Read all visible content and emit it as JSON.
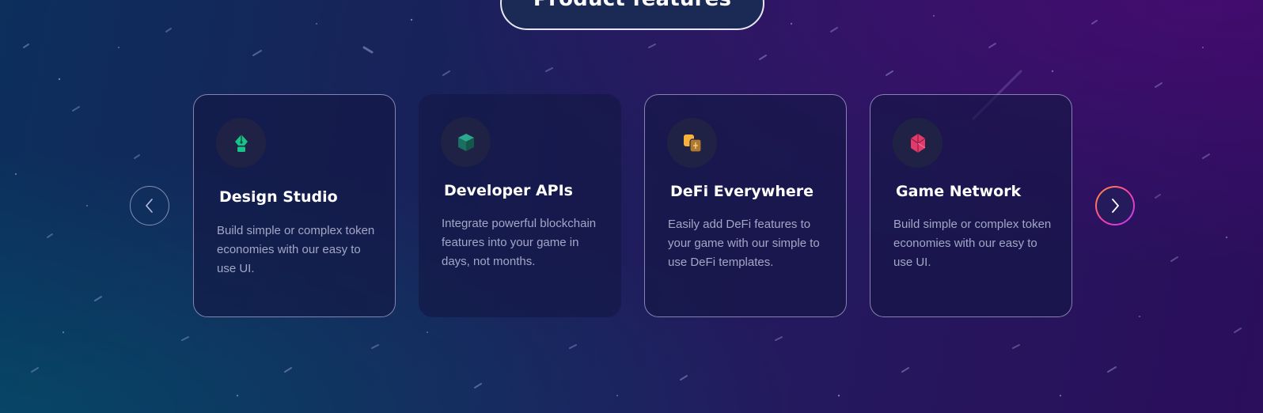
{
  "section": {
    "heading": "Product features"
  },
  "carousel": {
    "prev_icon": "chevron-left-icon",
    "next_icon": "chevron-right-icon",
    "cards": [
      {
        "title": "Design Studio",
        "description": "Build simple or complex token economies with our easy to use UI.",
        "icon": "pen-nib-icon",
        "icon_color": "#19c28a"
      },
      {
        "title": "Developer APIs",
        "description": "Integrate powerful blockchain features into your game in days, not months.",
        "icon": "cube-icon",
        "icon_color": "#1f8a78"
      },
      {
        "title": "DeFi Everywhere",
        "description": "Easily add DeFi features to your game with our simple to use DeFi templates.",
        "icon": "coins-icon",
        "icon_color": "#f6b23c"
      },
      {
        "title": "Game Network",
        "description": "Build simple or complex token economies with our easy to use UI.",
        "icon": "gem-icon",
        "icon_color": "#e23a6a"
      }
    ]
  },
  "colors": {
    "card_border": "#b4b0dc",
    "next_button_gradient": [
      "#ff9a2e",
      "#ff3ea8",
      "#b53cff"
    ]
  }
}
